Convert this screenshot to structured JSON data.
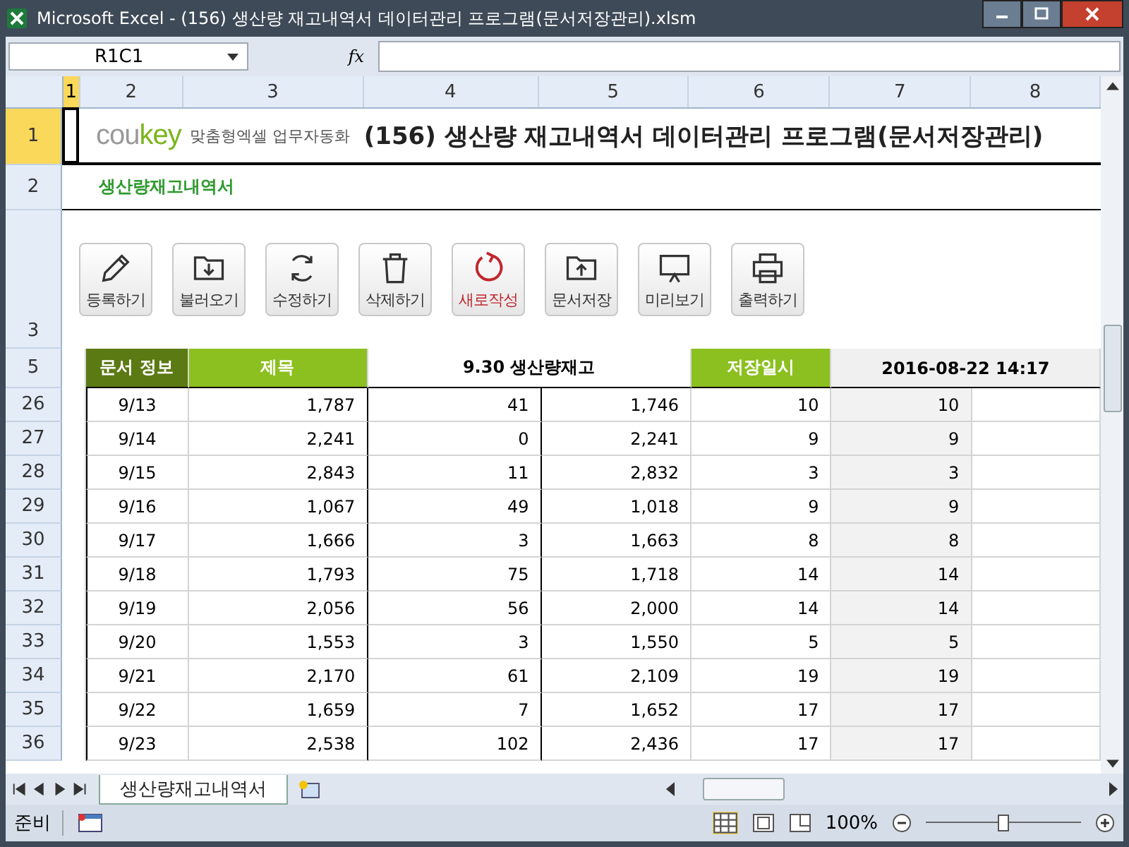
{
  "window": {
    "title": "Microsoft Excel - (156) 생산량 재고내역서 데이터관리 프로그램(문서저장관리).xlsm"
  },
  "formula_bar": {
    "name_box": "R1C1",
    "function_button": "fx"
  },
  "column_headers": [
    {
      "label": "1",
      "selected": true
    },
    {
      "label": "2",
      "selected": false
    },
    {
      "label": "3",
      "selected": false
    },
    {
      "label": "4",
      "selected": false
    },
    {
      "label": "5",
      "selected": false
    },
    {
      "label": "6",
      "selected": false
    },
    {
      "label": "7",
      "selected": false
    },
    {
      "label": "8",
      "selected": false
    }
  ],
  "header_rows": [
    {
      "label": "1",
      "selected": true
    },
    {
      "label": "2",
      "selected": false
    },
    {
      "label": "3",
      "selected": false
    },
    {
      "label": "5",
      "selected": false
    }
  ],
  "logo": {
    "part_1": "cou",
    "part_2": "key",
    "tagline": "맞춤형엑셀 업무자동화"
  },
  "title": "(156) 생산량 재고내역서 데이터관리 프로그램(문서저장관리)",
  "subtitle": "생산량재고내역서",
  "buttons": [
    {
      "kind": "pencil",
      "label": "등록하기",
      "color": "#333333"
    },
    {
      "kind": "folder-down",
      "label": "불러오기",
      "color": "#333333"
    },
    {
      "kind": "refresh",
      "label": "수정하기",
      "color": "#333333"
    },
    {
      "kind": "trash",
      "label": "삭제하기",
      "color": "#333333"
    },
    {
      "kind": "circle-arrow",
      "label": "새로작성",
      "color": "#c0272d"
    },
    {
      "kind": "folder-up",
      "label": "문서저장",
      "color": "#333333"
    },
    {
      "kind": "monitor",
      "label": "미리보기",
      "color": "#333333"
    },
    {
      "kind": "printer",
      "label": "출력하기",
      "color": "#333333"
    }
  ],
  "info": {
    "label": "문서 정보",
    "title_label": "제목",
    "title_value": "9.30 생산량재고",
    "saved_label": "저장일시",
    "saved_value": "2016-08-22 14:17"
  },
  "rows": [
    {
      "row": "26",
      "cells": [
        "9/13",
        "1,787",
        "41",
        "1,746",
        "10",
        "10"
      ]
    },
    {
      "row": "27",
      "cells": [
        "9/14",
        "2,241",
        "0",
        "2,241",
        "9",
        "9"
      ]
    },
    {
      "row": "28",
      "cells": [
        "9/15",
        "2,843",
        "11",
        "2,832",
        "3",
        "3"
      ]
    },
    {
      "row": "29",
      "cells": [
        "9/16",
        "1,067",
        "49",
        "1,018",
        "9",
        "9"
      ]
    },
    {
      "row": "30",
      "cells": [
        "9/17",
        "1,666",
        "3",
        "1,663",
        "8",
        "8"
      ]
    },
    {
      "row": "31",
      "cells": [
        "9/18",
        "1,793",
        "75",
        "1,718",
        "14",
        "14"
      ]
    },
    {
      "row": "32",
      "cells": [
        "9/19",
        "2,056",
        "56",
        "2,000",
        "14",
        "14"
      ]
    },
    {
      "row": "33",
      "cells": [
        "9/20",
        "1,553",
        "3",
        "1,550",
        "5",
        "5"
      ]
    },
    {
      "row": "34",
      "cells": [
        "9/21",
        "2,170",
        "61",
        "2,109",
        "19",
        "19"
      ]
    },
    {
      "row": "35",
      "cells": [
        "9/22",
        "1,659",
        "7",
        "1,652",
        "17",
        "17"
      ]
    },
    {
      "row": "36",
      "cells": [
        "9/23",
        "2,538",
        "102",
        "2,436",
        "17",
        "17"
      ]
    }
  ],
  "sheet_tabs": [
    {
      "label": "생산량재고내역서",
      "selected": true
    }
  ],
  "status_bar": {
    "status": "준비",
    "zoom": "100%",
    "zoom_slider": {
      "level": 0.5
    }
  }
}
